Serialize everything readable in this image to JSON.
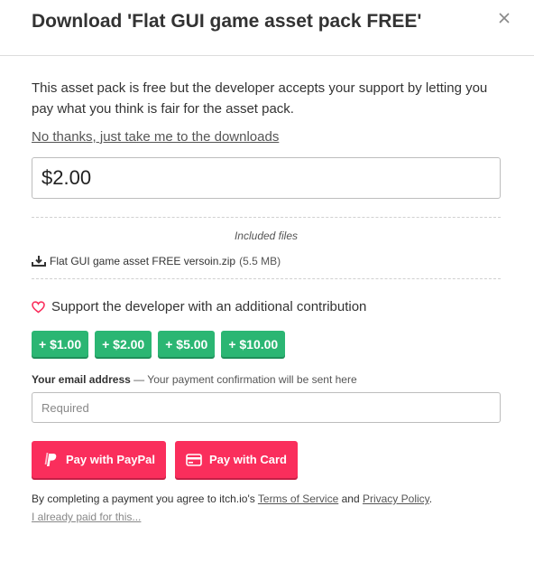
{
  "dialog": {
    "title": "Download 'Flat GUI game asset pack FREE'",
    "intro": "This asset pack is free but the developer accepts your support by letting you pay what you think is fair for the asset pack.",
    "no_thanks": "No thanks, just take me to the downloads",
    "amount": "$2.00",
    "files": {
      "label": "Included files",
      "name": "Flat GUI game asset FREE versoin.zip",
      "size": "(5.5 MB)"
    },
    "support": "Support the developer with an additional contribution",
    "tips": [
      "+ $1.00",
      "+ $2.00",
      "+ $5.00",
      "+ $10.00"
    ],
    "email": {
      "label": "Your email address",
      "hint": "— Your payment confirmation will be sent here",
      "placeholder": "Required"
    },
    "pay": {
      "paypal": "Pay with PayPal",
      "card": "Pay with Card"
    },
    "terms": {
      "prefix": "By completing a payment you agree to itch.io's",
      "tos": "Terms of Service",
      "and": "and",
      "privacy": "Privacy Policy",
      "suffix": "."
    },
    "already_paid": "I already paid for this..."
  },
  "colors": {
    "tip_green": "#2bb673",
    "pay_red": "#fa2e5c",
    "heart": "#fa2e5c"
  },
  "icons": {
    "close": "close-icon",
    "download": "download-icon",
    "heart": "heart-icon",
    "paypal": "paypal-icon",
    "card": "credit-card-icon"
  }
}
